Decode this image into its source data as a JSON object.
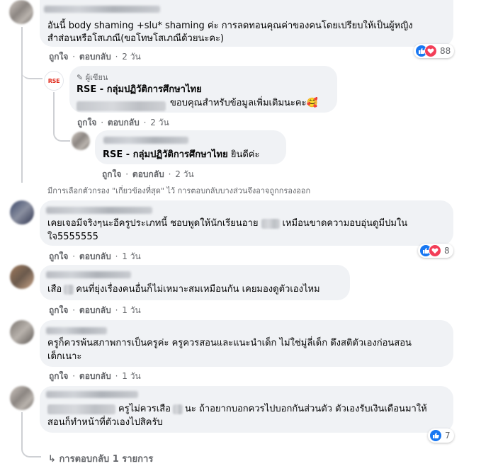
{
  "common": {
    "like": "ถูกใจ",
    "reply": "ตอบกลับ",
    "dot": "·"
  },
  "c1": {
    "line1": "อันนี้ body shaming +slu* shaming ค่ะ การลดทอนคุณค่าของคนโดยเปรียบให้เป็นผู้หญิง",
    "line2": "สำส่อนหรือโสเภณี(ขอโทษโสเภณีด้วยนะคะ)",
    "time": "2 วัน",
    "reaction_count": "88"
  },
  "r1": {
    "avatar_text": "RSE",
    "author_badge": "ผู้เขียน",
    "name": "RSE - กลุ่มปฏิวัติการศึกษาไทย",
    "text": "ขอบคุณสำหรับข้อมูลเพิ่มเติมนะคะ🥰",
    "time": "2 วัน"
  },
  "r2": {
    "name": "RSE - กลุ่มปฏิวัติการศึกษาไทย",
    "text": "ยินดีค่ะ",
    "time": "2 วัน"
  },
  "filter_notice": "มีการเลือกตัวกรอง \"เกี่ยวข้องที่สุด\" ไว้ การตอบกลับบางส่วนจึงอาจถูกกรองออก",
  "c2": {
    "line1a": "เคยเจอมีจริงๆนะอีครูประเภทนี้ ชอบพูดให้นักเรียนอาย",
    "line1b": "เหมือนขาดความอบอุ่นดูมีปมใน",
    "line2": "ใจ5555555",
    "time": "1 วัน",
    "reaction_count": "8"
  },
  "c3": {
    "line1a": "เสือ",
    "line1b": "คนที่ยุ่งเรื่องคนอื่นก็ไม่เหมาะสมเหมือนกัน เคยมองดูตัวเองไหม",
    "time": "1 วัน"
  },
  "c4": {
    "line1": "ครูก็ควรพ้นสภาพการเป็นครูค่ะ ครูควรสอนและแนะนำเด็ก ไม่ใช่มู่ลี่เด็ก ดึงสติตัวเองก่อนสอน",
    "line2": "เด็กเนาะ",
    "time": "1 วัน"
  },
  "c5": {
    "line1a": "ครูไม่ควรเสือ",
    "line1b": "นะ ถ้าอยากบอกควรไปบอกกันส่วนตัว ตัวเองรับเงินเดือนมาให้",
    "line2": "สอนก็ทำหน้าที่ตัวเองไปสิครับ",
    "reaction_count": "7"
  },
  "more_replies": "การตอบกลับ 1 รายการ",
  "colors": {
    "like_blue": "#1877f2",
    "love_red": "#f33e58",
    "bubble": "#f0f2f5",
    "meta_gray": "#65676b",
    "rse_red": "#e02b1d"
  }
}
